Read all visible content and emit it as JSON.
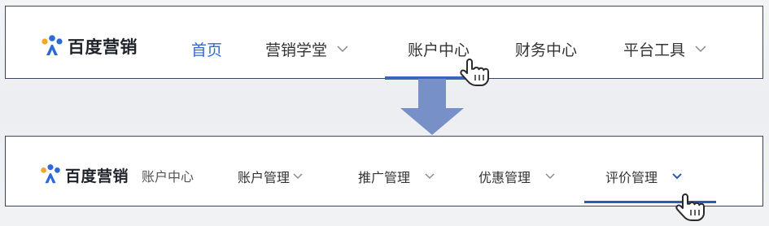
{
  "top_nav": {
    "logo_text": "百度营销",
    "items": [
      {
        "label": "首页",
        "active": true,
        "has_dropdown": false
      },
      {
        "label": "营销学堂",
        "active": false,
        "has_dropdown": true
      },
      {
        "label": "账户中心",
        "active": false,
        "has_dropdown": false,
        "hovered": true
      },
      {
        "label": "财务中心",
        "active": false,
        "has_dropdown": false
      },
      {
        "label": "平台工具",
        "active": false,
        "has_dropdown": true
      }
    ]
  },
  "bottom_nav": {
    "logo_text": "百度营销",
    "sub_title": "账户中心",
    "items": [
      {
        "label": "账户管理",
        "has_dropdown": true
      },
      {
        "label": "推广管理",
        "has_dropdown": true
      },
      {
        "label": "优惠管理",
        "has_dropdown": true
      },
      {
        "label": "评价管理",
        "has_dropdown": true,
        "hovered": true
      }
    ]
  },
  "icons": {
    "logo": "baidu-marketing-logo-icon",
    "dropdown": "chevron-down-icon",
    "cursor": "hand-pointer-icon",
    "transition": "down-arrow-icon"
  },
  "colors": {
    "active": "#2d6ad8",
    "underline": "#3a66b8",
    "arrow": "#7890c8",
    "frame_border": "#3a4560"
  }
}
